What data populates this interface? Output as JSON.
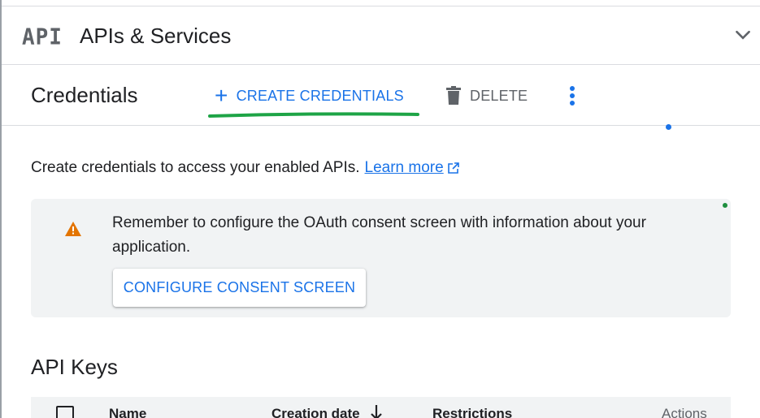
{
  "header": {
    "logo_text": "API",
    "title": "APIs & Services",
    "expand_icon": "chevron-down-icon"
  },
  "toolbar": {
    "page_title": "Credentials",
    "create_label": "CREATE CREDENTIALS",
    "create_icon": "+",
    "delete_label": "DELETE",
    "delete_icon": "trash-icon",
    "more_icon": "more-vert-icon",
    "highlight_color": "#1ea446"
  },
  "intro": {
    "text": "Create credentials to access your enabled APIs.",
    "learn_more": "Learn more",
    "external_icon": "open-in-new-icon"
  },
  "banner": {
    "icon": "warning-icon",
    "message": "Remember to configure the OAuth consent screen with information about your application.",
    "button_label": "CONFIGURE CONSENT SCREEN"
  },
  "api_keys": {
    "title": "API Keys",
    "columns": {
      "name": "Name",
      "creation_date": "Creation date",
      "restrictions": "Restrictions",
      "actions": "Actions"
    },
    "sort_icon": "arrow-down-icon"
  },
  "colors": {
    "accent": "#1a73e8",
    "warning": "#e37400",
    "banner_bg": "#f1f3f4",
    "text": "#202124",
    "muted": "#5f6368"
  }
}
